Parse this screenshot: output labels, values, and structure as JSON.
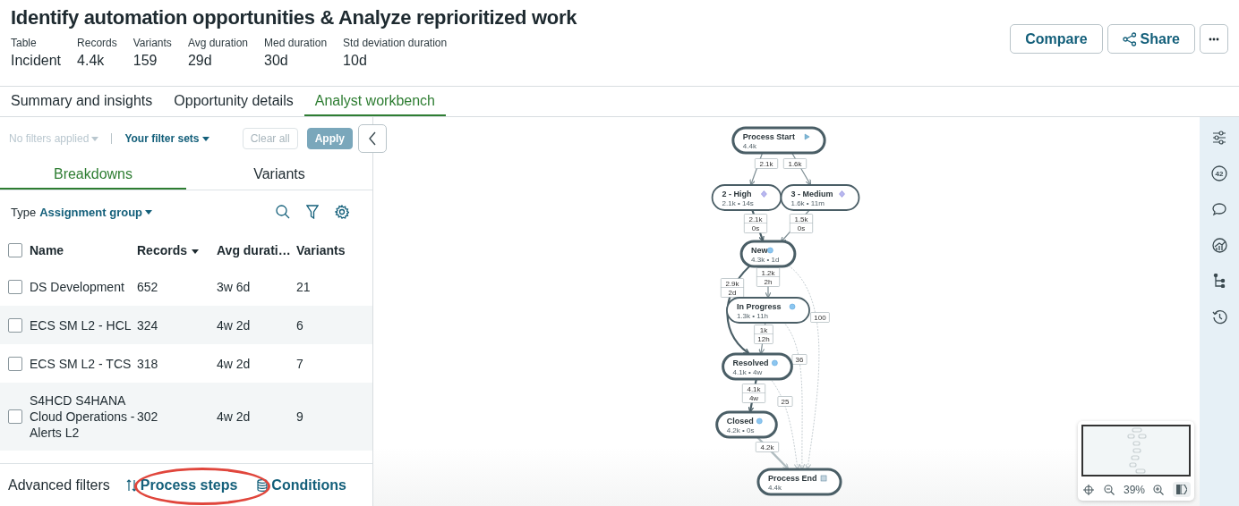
{
  "header": {
    "title": "Identify automation opportunities & Analyze reprioritized work",
    "stats": [
      {
        "label": "Table",
        "value": "Incident"
      },
      {
        "label": "Records",
        "value": "4.4k"
      },
      {
        "label": "Variants",
        "value": "159"
      },
      {
        "label": "Avg duration",
        "value": "29d"
      },
      {
        "label": "Med duration",
        "value": "30d"
      },
      {
        "label": "Std deviation duration",
        "value": "10d"
      }
    ],
    "buttons": [
      {
        "kind": "text",
        "label": "Compare"
      },
      {
        "kind": "share",
        "label": "Share"
      },
      {
        "kind": "more"
      }
    ]
  },
  "tabs": [
    {
      "label": "Summary and insights",
      "selected": false
    },
    {
      "label": "Opportunity details",
      "selected": false
    },
    {
      "label": "Analyst workbench",
      "selected": true
    }
  ],
  "filters": {
    "applied": "No filters applied",
    "filter_sets": "Your filter sets",
    "buttons": [
      {
        "label": "Clear all",
        "kind": "secondary",
        "disabled": true
      },
      {
        "label": "Apply",
        "kind": "primary",
        "disabled": true
      }
    ]
  },
  "panel_tabs": [
    {
      "label": "Breakdowns",
      "selected": true
    },
    {
      "label": "Variants",
      "selected": false
    }
  ],
  "type_selector": {
    "label": "Type",
    "value": "Assignment group"
  },
  "table": {
    "header_checked": false,
    "columns": [
      {
        "label": "Name",
        "sorted": false
      },
      {
        "label": "Records",
        "sorted": true
      },
      {
        "label": "Avg durati…",
        "sorted": false
      },
      {
        "label": "Variants",
        "sorted": false
      }
    ],
    "rows": [
      {
        "checked": false,
        "cells": [
          "DS Development",
          "652",
          "3w 6d",
          "21"
        ]
      },
      {
        "checked": false,
        "cells": [
          "ECS SM L2 - HCL",
          "324",
          "4w 2d",
          "6"
        ]
      },
      {
        "checked": false,
        "cells": [
          "ECS SM L2 - TCS",
          "318",
          "4w 2d",
          "7"
        ]
      },
      {
        "checked": false,
        "cells": [
          "S4HCD S4HANA Cloud Operations - Alerts L2",
          "302",
          "4w 2d",
          "9"
        ]
      }
    ]
  },
  "advanced_filters": {
    "label": "Advanced filters",
    "links": [
      {
        "kind": "steps",
        "label": "Process steps",
        "highlighted": true
      },
      {
        "kind": "conditions",
        "label": "Conditions",
        "highlighted": false
      }
    ]
  },
  "map": {
    "nodes": [
      {
        "kind": "start",
        "label": "Process Start",
        "stats": "4.4k"
      },
      {
        "kind": "priority",
        "label": "2 - High",
        "stats": "2.1k • 14s"
      },
      {
        "kind": "priority",
        "label": "3 - Medium",
        "stats": "1.6k • 11m"
      },
      {
        "kind": "state",
        "label": "New",
        "stats": "4.3k • 1d"
      },
      {
        "kind": "state",
        "label": "In Progress",
        "stats": "1.3k • 11h"
      },
      {
        "kind": "state",
        "label": "Resolved",
        "stats": "4.1k • 4w"
      },
      {
        "kind": "state",
        "label": "Closed",
        "stats": "4.2k • 0s"
      },
      {
        "kind": "end",
        "label": "Process End",
        "stats": "4.4k"
      }
    ],
    "edges": [
      {
        "kind": "normal",
        "labels": [
          "2.1k"
        ]
      },
      {
        "kind": "normal",
        "labels": [
          "1.6k"
        ]
      },
      {
        "kind": "major",
        "labels": [
          "2.1k",
          "0s"
        ]
      },
      {
        "kind": "normal",
        "labels": [
          "1.5k",
          "0s"
        ]
      },
      {
        "kind": "normal",
        "labels": [
          "1.2k",
          "2h"
        ]
      },
      {
        "kind": "major",
        "labels": [
          "2.9k",
          "2d"
        ]
      },
      {
        "kind": "minor",
        "labels": [
          "100"
        ]
      },
      {
        "kind": "normal",
        "labels": [
          "1k",
          "12h"
        ]
      },
      {
        "kind": "minor",
        "labels": [
          "36"
        ]
      },
      {
        "kind": "major",
        "labels": [
          "4.1k",
          "4w"
        ]
      },
      {
        "kind": "minor",
        "labels": [
          "25"
        ]
      },
      {
        "kind": "faded",
        "labels": [
          "4.2k"
        ]
      }
    ]
  },
  "minimap": {
    "zoom": "39%"
  },
  "sidebar": {
    "tools": [
      {
        "kind": "sliders"
      },
      {
        "kind": "count",
        "label": "42"
      },
      {
        "kind": "comment"
      },
      {
        "kind": "chart"
      },
      {
        "kind": "tree"
      },
      {
        "kind": "history"
      }
    ]
  }
}
